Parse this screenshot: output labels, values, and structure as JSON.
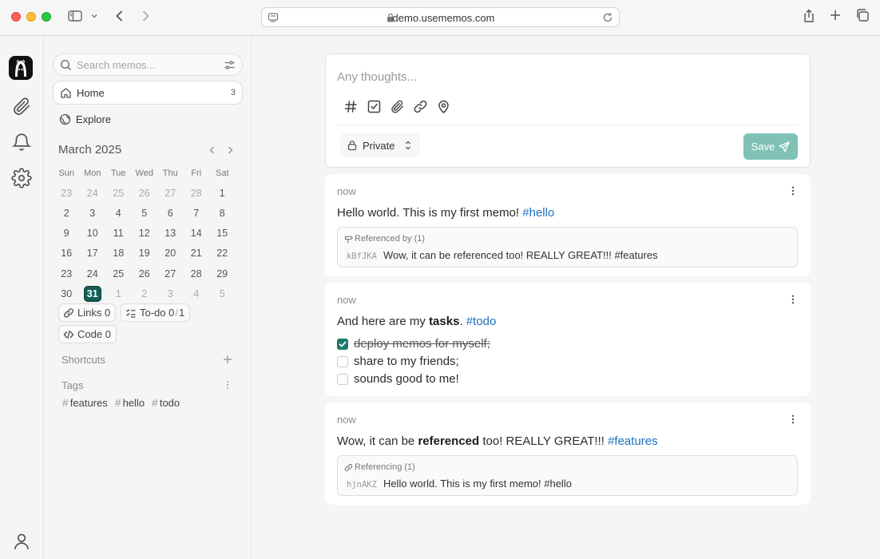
{
  "browser": {
    "url": "demo.usememos.com",
    "icons": [
      "sidebar-icon",
      "chevron-down-icon",
      "back-icon",
      "forward-icon",
      "reload-icon",
      "share-icon",
      "new-tab-icon",
      "tabs-overview-icon"
    ]
  },
  "rail": {
    "items": [
      "memos-logo",
      "paperclip-icon",
      "bell-icon",
      "gear-icon",
      "user-icon"
    ]
  },
  "sidebar": {
    "search_placeholder": "Search memos...",
    "nav": [
      {
        "label": "Home",
        "count": "3",
        "icon": "home-icon"
      },
      {
        "label": "Explore",
        "icon": "globe-icon"
      }
    ],
    "calendar": {
      "month": "March 2025",
      "weekdays": [
        "Sun",
        "Mon",
        "Tue",
        "Wed",
        "Thu",
        "Fri",
        "Sat"
      ],
      "weeks": [
        [
          "23",
          "24",
          "25",
          "26",
          "27",
          "28",
          "1"
        ],
        [
          "2",
          "3",
          "4",
          "5",
          "6",
          "7",
          "8"
        ],
        [
          "9",
          "10",
          "11",
          "12",
          "13",
          "14",
          "15"
        ],
        [
          "16",
          "17",
          "18",
          "19",
          "20",
          "21",
          "22"
        ],
        [
          "23",
          "24",
          "25",
          "26",
          "27",
          "28",
          "29"
        ],
        [
          "30",
          "31",
          "1",
          "2",
          "3",
          "4",
          "5"
        ]
      ],
      "today": "31"
    },
    "stats": {
      "links_label": "Links",
      "links_count": "0",
      "todo_label": "To-do",
      "todo_done": "0",
      "todo_sep": "/",
      "todo_total": "1",
      "code_label": "Code",
      "code_count": "0"
    },
    "shortcuts_title": "Shortcuts",
    "tags_title": "Tags",
    "tags": [
      "features",
      "hello",
      "todo"
    ]
  },
  "editor": {
    "placeholder": "Any thoughts...",
    "tools": [
      "hash-icon",
      "checkbox-icon",
      "paperclip-icon",
      "link-icon",
      "map-pin-icon"
    ],
    "visibility": "Private",
    "save_label": "Save",
    "save_color": "#7fc1b5"
  },
  "memos": [
    {
      "time": "now",
      "content": {
        "text": "Hello world. This is my first memo! ",
        "tag": "#hello"
      },
      "ref": {
        "heading": "Referenced by (1)",
        "id": "kBfJKA",
        "text": "Wow, it can be referenced too! REALLY GREAT!!! #features"
      }
    },
    {
      "time": "now",
      "content": {
        "pre": "And here are my ",
        "bold": "tasks",
        "post": ". ",
        "tag": "#todo"
      },
      "tasks": [
        {
          "text": "deploy memos for myself;",
          "done": true
        },
        {
          "text": "share to my friends;",
          "done": false
        },
        {
          "text": "sounds good to me!",
          "done": false
        }
      ]
    },
    {
      "time": "now",
      "content": {
        "pre": "Wow, it can be ",
        "bold": "referenced",
        "post": " too! REALLY GREAT!!! ",
        "tag": "#features"
      },
      "ref": {
        "heading": "Referencing (1)",
        "id": "hjnAKZ",
        "text": "Hello world. This is my first memo! #hello"
      }
    }
  ],
  "colors": {
    "accent": "#155e57",
    "hashtag": "#1f6fbf",
    "checkbox": "#1e7a6c"
  }
}
